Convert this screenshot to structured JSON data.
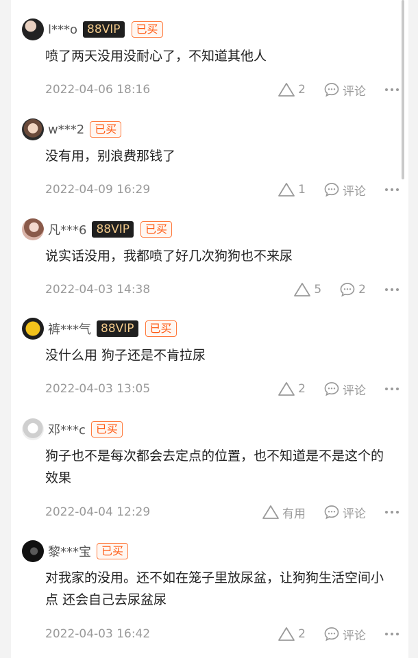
{
  "comments": [
    {
      "user": "l***o",
      "vip": "88VIP",
      "bought": "已买",
      "text": "喷了两天没用没耐心了，不知道其他人",
      "date": "2022-04-06 18:16",
      "likes": "2",
      "reply": "评论"
    },
    {
      "user": "w***2",
      "vip": "",
      "bought": "已买",
      "text": "没有用，别浪费那钱了",
      "date": "2022-04-09 16:29",
      "likes": "1",
      "reply": "评论"
    },
    {
      "user": "凡***6",
      "vip": "88VIP",
      "bought": "已买",
      "text": "说实话没用，我都喷了好几次狗狗也不来尿",
      "date": "2022-04-03 14:38",
      "likes": "5",
      "reply": "2"
    },
    {
      "user": "裤***气",
      "vip": "88VIP",
      "bought": "已买",
      "text": "没什么用 狗子还是不肯拉尿",
      "date": "2022-04-03 13:05",
      "likes": "2",
      "reply": "评论"
    },
    {
      "user": "邓***c",
      "vip": "",
      "bought": "已买",
      "text": "狗子也不是每次都会去定点的位置，也不知道是不是这个的效果",
      "date": "2022-04-04 12:29",
      "likes": "有用",
      "reply": "评论"
    },
    {
      "user": "黎***宝",
      "vip": "",
      "bought": "已买",
      "text": "对我家的没用。还不如在笼子里放尿盆，让狗狗生活空间小点 还会自己去尿盆尿",
      "date": "2022-04-03 16:42",
      "likes": "2",
      "reply": "评论"
    }
  ],
  "icons": {
    "like": "triangle-like-icon",
    "comment": "speech-bubble-icon",
    "more": "more-dots-icon"
  }
}
